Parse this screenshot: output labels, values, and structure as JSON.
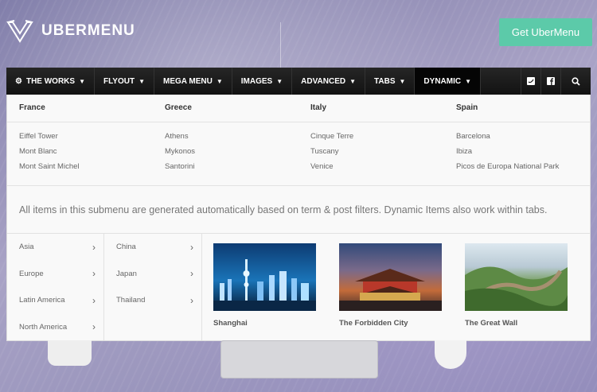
{
  "brand": {
    "name": "UBERMENU",
    "cta_label": "Get UberMenu"
  },
  "nav": {
    "items": [
      {
        "label": "THE WORKS",
        "active": false,
        "has_gear": true
      },
      {
        "label": "FLYOUT"
      },
      {
        "label": "MEGA MENU"
      },
      {
        "label": "IMAGES"
      },
      {
        "label": "ADVANCED"
      },
      {
        "label": "TABS"
      },
      {
        "label": "DYNAMIC",
        "active": true
      }
    ],
    "icons": [
      "twitter-icon",
      "facebook-icon",
      "search-icon"
    ]
  },
  "columns": [
    {
      "heading": "France",
      "items": [
        "Eiffel Tower",
        "Mont Blanc",
        "Mont Saint Michel"
      ]
    },
    {
      "heading": "Greece",
      "items": [
        "Athens",
        "Mykonos",
        "Santorini"
      ]
    },
    {
      "heading": "Italy",
      "items": [
        "Cinque Terre",
        "Tuscany",
        "Venice"
      ]
    },
    {
      "heading": "Spain",
      "items": [
        "Barcelona",
        "Ibiza",
        "Picos de Europa National Park"
      ]
    }
  ],
  "description": "All items in this submenu are generated automatically based on term & post filters. Dynamic Items also work within tabs.",
  "regions": [
    "Asia",
    "Europe",
    "Latin America",
    "North America"
  ],
  "subregions": [
    "China",
    "Japan",
    "Thailand"
  ],
  "cards": [
    {
      "title": "Shanghai"
    },
    {
      "title": "The Forbidden City"
    },
    {
      "title": "The Great Wall"
    }
  ],
  "colors": {
    "accent": "#5ccaa9",
    "nav_bg": "#1a1a1a",
    "panel_bg": "#f9f9f9"
  }
}
